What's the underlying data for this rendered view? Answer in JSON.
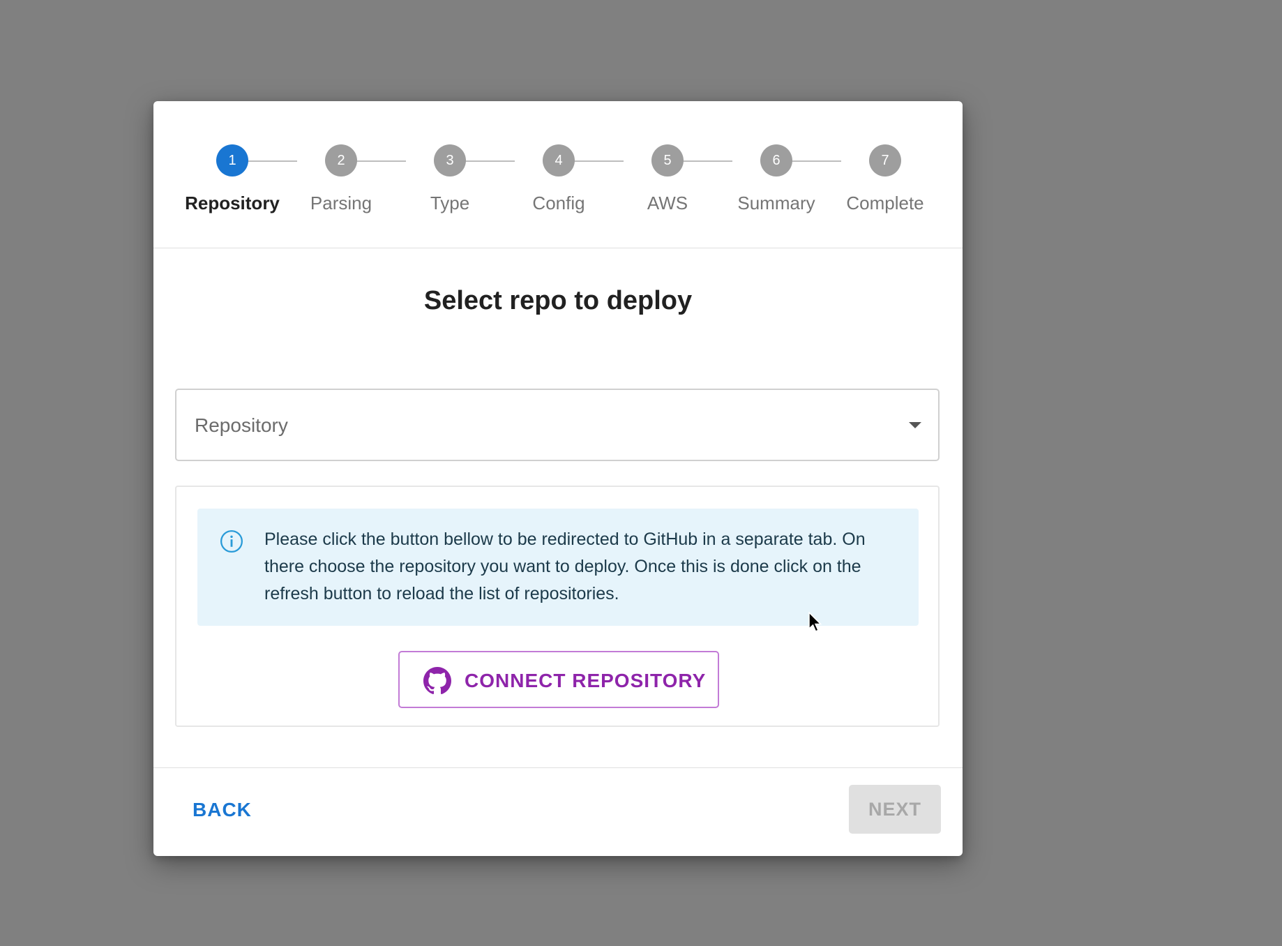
{
  "stepper": {
    "steps": [
      {
        "number": "1",
        "label": "Repository",
        "active": true
      },
      {
        "number": "2",
        "label": "Parsing",
        "active": false
      },
      {
        "number": "3",
        "label": "Type",
        "active": false
      },
      {
        "number": "4",
        "label": "Config",
        "active": false
      },
      {
        "number": "5",
        "label": "AWS",
        "active": false
      },
      {
        "number": "6",
        "label": "Summary",
        "active": false
      },
      {
        "number": "7",
        "label": "Complete",
        "active": false
      }
    ]
  },
  "main": {
    "title": "Select repo to deploy",
    "repository_select": {
      "placeholder": "Repository"
    },
    "info_alert": {
      "icon": "info-icon",
      "text": "Please click the button bellow to be redirected to GitHub in a separate tab. On there choose the repository you want to deploy. Once this is done click on the refresh button to reload the list of repositories."
    },
    "connect_button": {
      "icon": "github-icon",
      "label": "CONNECT REPOSITORY"
    }
  },
  "footer": {
    "back_label": "BACK",
    "next_label": "NEXT"
  },
  "colors": {
    "accent": "#1976d2",
    "inactive_step": "#9e9e9e",
    "connect": "#8e24aa",
    "alert_bg": "#e6f4fb",
    "backdrop": "#808080"
  }
}
